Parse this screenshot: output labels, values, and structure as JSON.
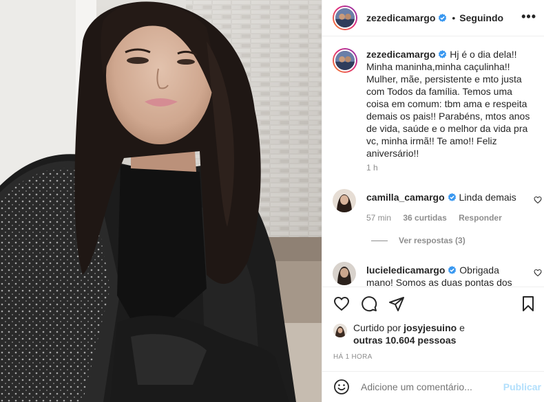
{
  "post": {
    "author": "zezedicamargo",
    "follow_status": "Seguindo",
    "more_icon": "•••",
    "caption": "Hj é o dia dela!! Minha maninha,minha caçulinha!! Mulher, mãe, persistente e mto justa com Todos da família. Temos uma coisa em comum: tbm ama e respeita demais os pais!! Parabéns, mtos anos de vida, saúde e o melhor da vida pra vc, minha irmã!! Te amo!! Feliz aniversário!!",
    "caption_time": "1 h"
  },
  "comments": [
    {
      "user": "camilla_camargo",
      "text": "Linda demais",
      "time": "57 min",
      "likes": "36 curtidas",
      "reply_label": "Responder",
      "view_replies": "Ver respostas (3)"
    },
    {
      "user": "lucieledicamargo",
      "text": "Obrigada mano! Somos as duas pontas dos"
    }
  ],
  "likes": {
    "prefix": "Curtido por",
    "user": "josyjesuino",
    "conjunction": "e",
    "others": "outras 10.604 pessoas"
  },
  "time_ago": "HÁ 1 HORA",
  "add_comment": {
    "placeholder": "Adicione um comentário...",
    "publish": "Publicar"
  },
  "colors": {
    "verified": "#3897f0",
    "publish_disabled": "#b2dffc",
    "secondary_text": "#8e8e8e"
  },
  "icons": [
    "heart-icon",
    "comment-icon",
    "share-icon",
    "bookmark-icon",
    "emoji-icon",
    "verified-icon",
    "more-options-icon"
  ]
}
